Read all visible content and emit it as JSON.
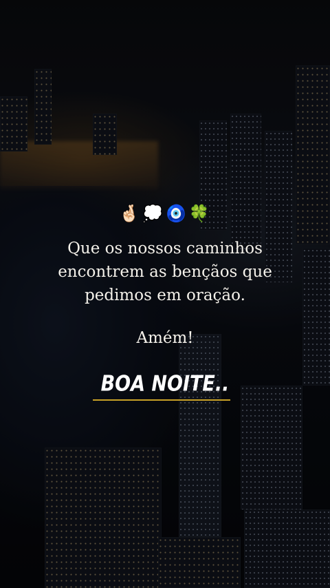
{
  "emojis": [
    "🤞🏻",
    "💭",
    "🧿",
    "🍀"
  ],
  "message": {
    "line1": "Que os nossos caminhos",
    "line2": "encontrem as bençãos que",
    "line3": "pedimos em oração."
  },
  "closing": "Amém!",
  "greeting": "BOA NOITE..",
  "colors": {
    "text": "#f4f1ea",
    "underline": "#c9a227",
    "background": "#0a0d14"
  }
}
